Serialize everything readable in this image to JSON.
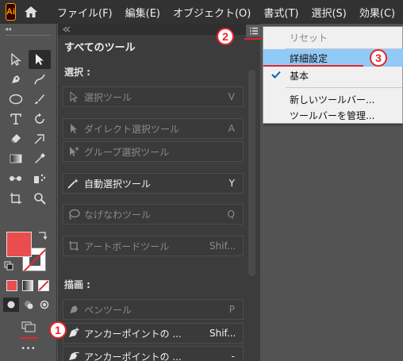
{
  "menubar": {
    "app_logo": "Ai",
    "items": [
      "ファイル(F)",
      "編集(E)",
      "オブジェクト(O)",
      "書式(T)",
      "選択(S)",
      "効果(C)",
      "表"
    ]
  },
  "toolbar": {
    "collapse": "◂◂",
    "more_label": "•••"
  },
  "panel": {
    "title": "すべてのツール",
    "sections": [
      {
        "label": "選択 :"
      },
      {
        "label": "描画 :"
      }
    ],
    "rows": [
      {
        "label": "選択ツール",
        "key": "V",
        "icon": "selection-arrow-icon",
        "state": "dim"
      },
      {
        "label": "ダイレクト選択ツール",
        "key": "A",
        "icon": "direct-selection-icon",
        "state": "dim"
      },
      {
        "label": "グループ選択ツール",
        "key": "",
        "icon": "group-selection-icon",
        "state": "dim"
      },
      {
        "label": "自動選択ツール",
        "key": "Y",
        "icon": "magic-wand-icon",
        "state": "active"
      },
      {
        "label": "なげなわツール",
        "key": "Q",
        "icon": "lasso-icon",
        "state": "dim"
      },
      {
        "label": "アートボードツール",
        "key": "Shif...",
        "icon": "artboard-icon",
        "state": "dim"
      },
      {
        "label": "ペンツール",
        "key": "P",
        "icon": "pen-icon",
        "state": "dim"
      },
      {
        "label": "アンカーポイントの ...",
        "key": "Shif...",
        "icon": "add-anchor-icon",
        "state": "active"
      },
      {
        "label": "アンカーポイントの ...",
        "key": "-",
        "icon": "delete-anchor-icon",
        "state": "active"
      }
    ]
  },
  "dropdown": {
    "items": [
      {
        "label": "リセット",
        "state": "disabled"
      },
      {
        "label": "詳細設定",
        "state": "highlight"
      },
      {
        "label": "基本",
        "state": "checked"
      },
      {
        "label": "新しいツールバー...",
        "state": "normal"
      },
      {
        "label": "ツールバーを管理...",
        "state": "normal"
      }
    ]
  },
  "annotations": [
    "1",
    "2",
    "3"
  ],
  "colors": {
    "accent_red": "#e8232a",
    "highlight_blue": "#91c9f7",
    "fill_swatch": "#ea4d4d"
  }
}
